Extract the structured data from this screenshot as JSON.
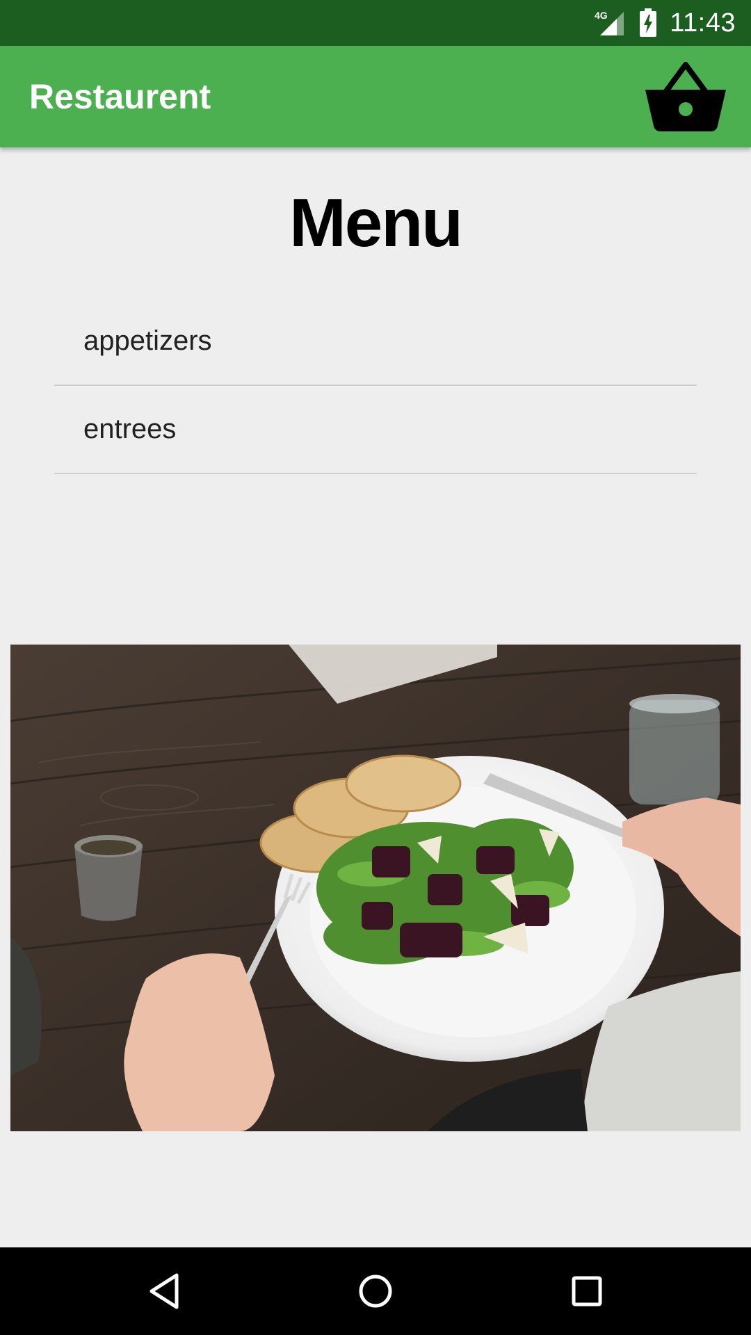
{
  "status_bar": {
    "network_label": "4G",
    "time": "11:43"
  },
  "app_bar": {
    "title": "Restaurent",
    "cart_icon": "shopping-basket-icon"
  },
  "main": {
    "heading": "Menu",
    "menu_items": [
      {
        "label": "appetizers"
      },
      {
        "label": "entrees"
      }
    ],
    "image_icon": "salad-plate-photo"
  },
  "nav_bar": {
    "back_icon": "back-triangle-icon",
    "home_icon": "home-circle-icon",
    "recents_icon": "recents-square-icon"
  },
  "colors": {
    "status_bar": "#1b5e20",
    "app_bar": "#4caf50",
    "background": "#eeeeee",
    "nav_bar": "#000000"
  }
}
